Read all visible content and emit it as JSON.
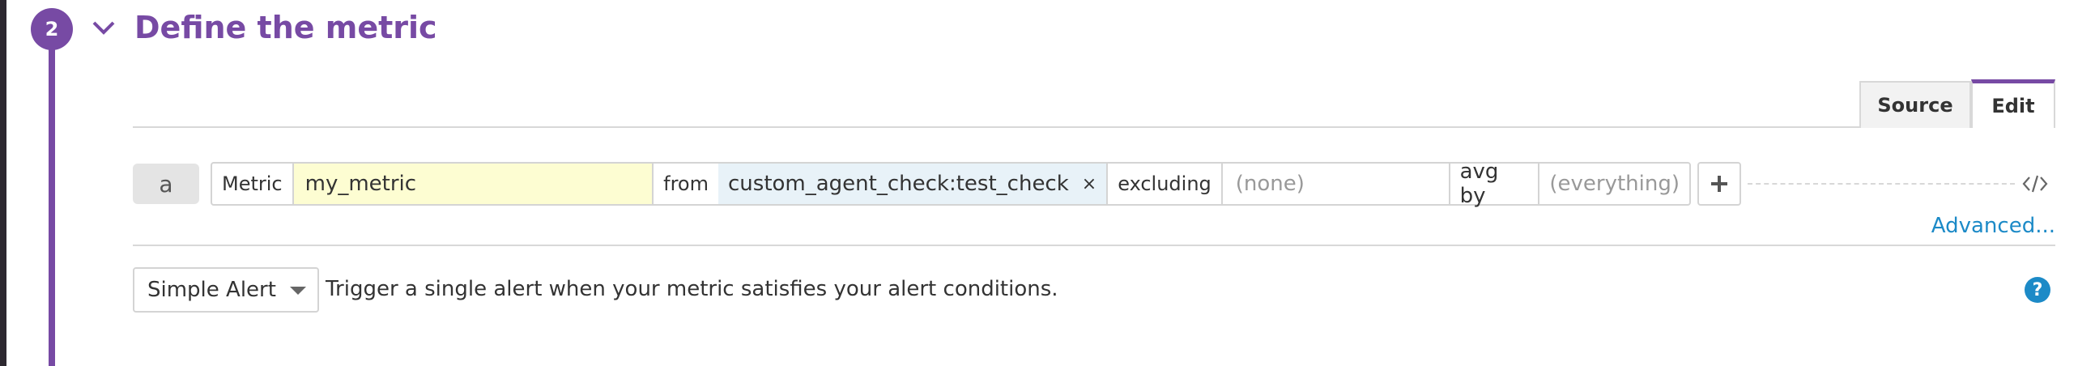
{
  "step": {
    "number": "2",
    "title": "Define the metric"
  },
  "tabs": [
    {
      "label": "Source"
    },
    {
      "label": "Edit"
    }
  ],
  "query": {
    "letter": "a",
    "metric_label": "Metric",
    "metric_value": "my_metric",
    "from_label": "from",
    "from_tag": "custom_agent_check:test_check",
    "from_tag_remove": "×",
    "excluding_label": "excluding",
    "excluding_value": "(none)",
    "avg_by_label": "avg by",
    "avg_by_value": "(everything)"
  },
  "advanced_link": "Advanced...",
  "alert": {
    "type_selected": "Simple Alert",
    "description": "Trigger a single alert when your metric satisfies your alert conditions."
  },
  "colors": {
    "accent": "#774aa4",
    "link": "#1c8ac7",
    "metric_highlight": "#fdfdd2",
    "tag_bg": "#e8f2f8"
  },
  "icons": [
    "chevron-down-icon",
    "plus-icon",
    "code-icon",
    "help-icon"
  ]
}
